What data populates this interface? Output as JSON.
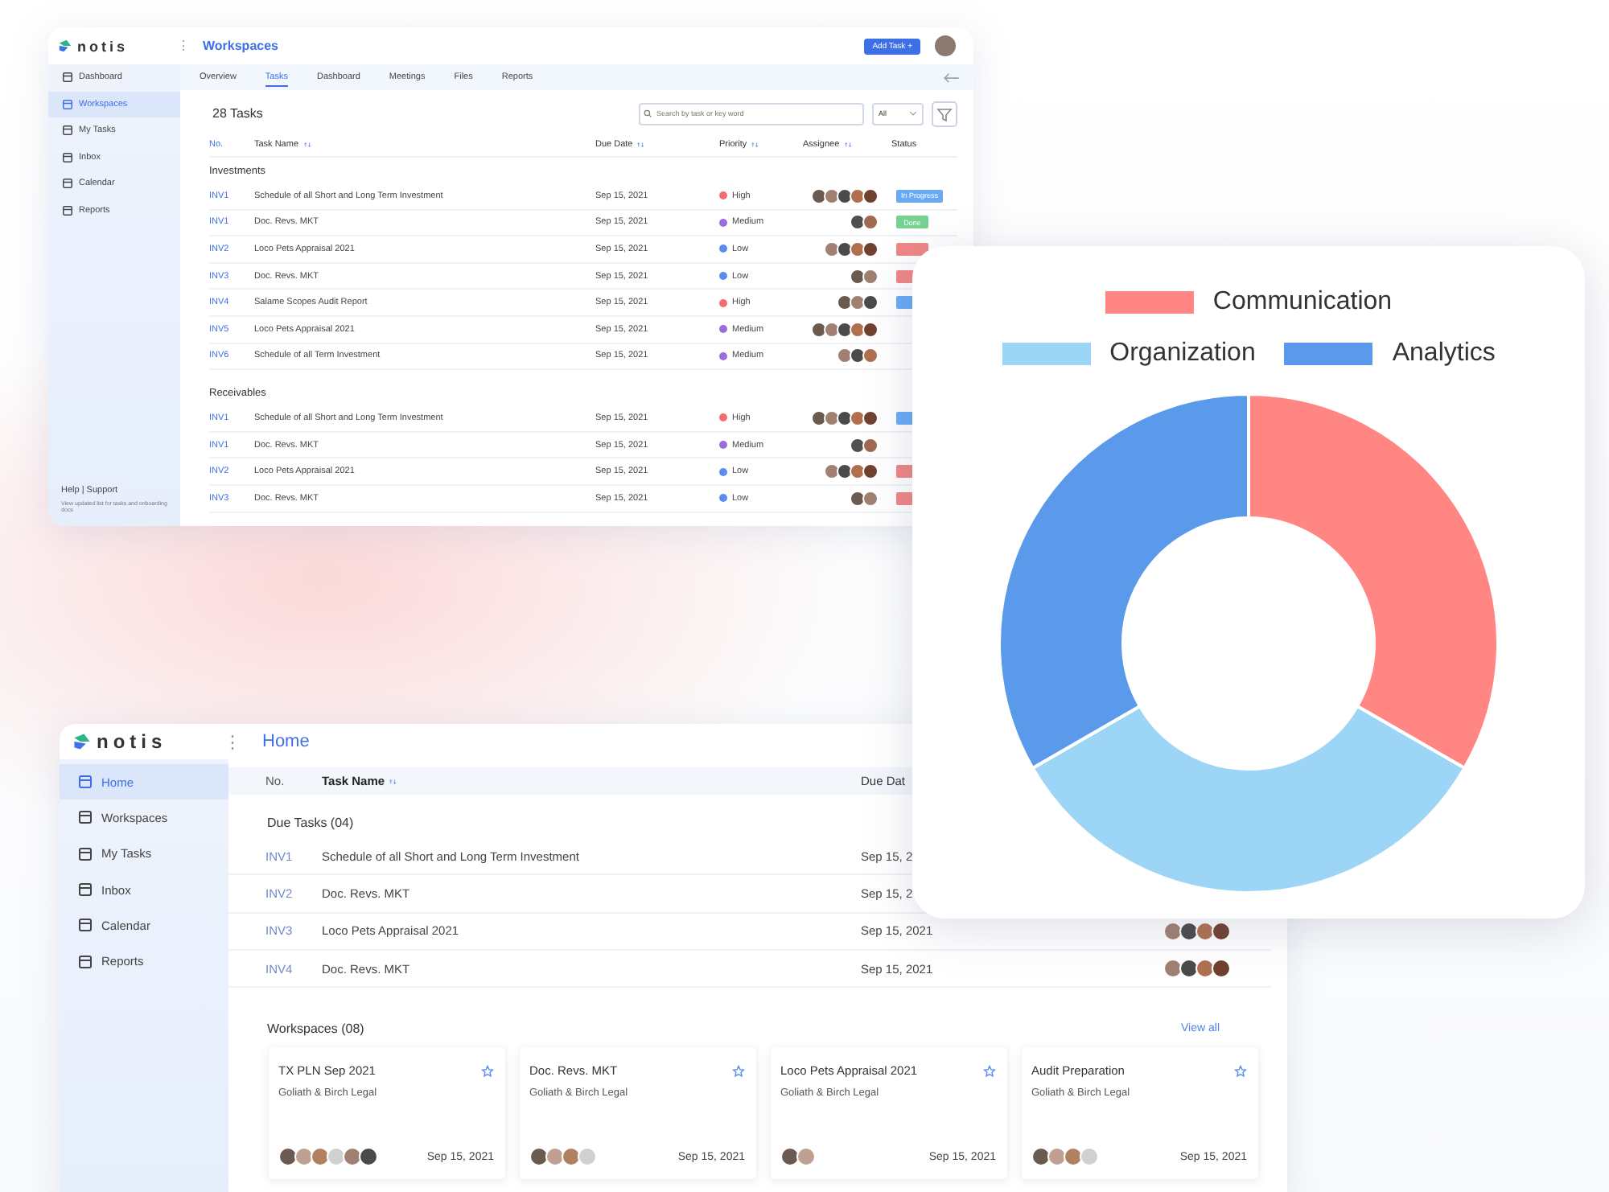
{
  "window_workspaces": {
    "logo": "notis",
    "menu_glyph": "⋮",
    "title": "Workspaces",
    "add_button": "Add Task +",
    "sidebar": {
      "items": [
        {
          "label": "Dashboard",
          "selected": false
        },
        {
          "label": "Workspaces",
          "selected": true
        },
        {
          "label": "My Tasks",
          "selected": false
        },
        {
          "label": "Inbox",
          "selected": false
        },
        {
          "label": "Calendar",
          "selected": false
        },
        {
          "label": "Reports",
          "selected": false
        }
      ],
      "help": "Help | Support",
      "note": "View updated list for tasks and onboarding docs"
    },
    "tabs": [
      {
        "label": "Overview",
        "selected": false
      },
      {
        "label": "Tasks",
        "selected": true
      },
      {
        "label": "Dashboard",
        "selected": false
      },
      {
        "label": "Meetings",
        "selected": false
      },
      {
        "label": "Files",
        "selected": false
      },
      {
        "label": "Reports",
        "selected": false
      }
    ],
    "task_count": "28 Tasks",
    "search": {
      "placeholder": "Search by task or key word"
    },
    "filter_select": "All",
    "columns": [
      "No.",
      "Task Name",
      "Due Date",
      "Priority",
      "Assignee",
      "Status"
    ],
    "groups": [
      {
        "title": "Investments",
        "rows": [
          {
            "no": "INV1",
            "name": "Schedule of all Short and Long Term Investment",
            "due": "Sep 15, 2021",
            "priority": {
              "label": "High",
              "color": "#f26d6d"
            },
            "avatars": [
              {
                "color": "#6b5a50"
              },
              {
                "color": "#a08070"
              },
              {
                "color": "#4a4a4a"
              },
              {
                "color": "#b07050"
              },
              {
                "color": "#704030"
              }
            ],
            "status": {
              "label": "In Progress",
              "color": "#6aaaf5"
            }
          },
          {
            "no": "INV1",
            "name": "Doc. Revs. MKT",
            "due": "Sep 15, 2021",
            "priority": {
              "label": "Medium",
              "color": "#9b6de0"
            },
            "avatars": [
              {
                "color": "#505050"
              },
              {
                "color": "#a06a50"
              }
            ],
            "status": {
              "label": "Done",
              "color": "#74d390"
            }
          },
          {
            "no": "INV2",
            "name": "Loco Pets Appraisal 2021",
            "due": "Sep 15, 2021",
            "priority": {
              "label": "Low",
              "color": "#5b8def"
            },
            "avatars": [
              {
                "color": "#a08070"
              },
              {
                "color": "#4a4a4a"
              },
              {
                "color": "#b07050"
              },
              {
                "color": "#704030"
              }
            ],
            "status": {
              "color": "#f08585"
            }
          },
          {
            "no": "INV3",
            "name": "Doc. Revs. MKT",
            "due": "Sep 15, 2021",
            "priority": {
              "label": "Low",
              "color": "#5b8def"
            },
            "avatars": [
              {
                "color": "#6b5a50"
              },
              {
                "color": "#a08070"
              }
            ],
            "status": {
              "color": "#f08585"
            }
          },
          {
            "no": "INV4",
            "name": "Salame Scopes Audit Report",
            "due": "Sep 15, 2021",
            "priority": {
              "label": "High",
              "color": "#f26d6d"
            },
            "avatars": [
              {
                "color": "#6b5a50"
              },
              {
                "color": "#a08070"
              },
              {
                "color": "#4a4a4a"
              }
            ],
            "status": {
              "color": "#6aaaf5"
            }
          },
          {
            "no": "INV5",
            "name": "Loco Pets Appraisal 2021",
            "due": "Sep 15, 2021",
            "priority": {
              "label": "Medium",
              "color": "#9b6de0"
            },
            "avatars": [
              {
                "color": "#6b5a50"
              },
              {
                "color": "#a08070"
              },
              {
                "color": "#4a4a4a"
              },
              {
                "color": "#b07050"
              },
              {
                "color": "#704030"
              }
            ]
          },
          {
            "no": "INV6",
            "name": "Schedule of all Term Investment",
            "due": "Sep 15, 2021",
            "priority": {
              "label": "Medium",
              "color": "#9b6de0"
            },
            "avatars": [
              {
                "color": "#a08070"
              },
              {
                "color": "#4a4a4a"
              },
              {
                "color": "#b07050"
              }
            ]
          }
        ]
      },
      {
        "title": "Receivables",
        "rows": [
          {
            "no": "INV1",
            "name": "Schedule of all Short and Long Term Investment",
            "due": "Sep 15, 2021",
            "priority": {
              "label": "High",
              "color": "#f26d6d"
            },
            "avatars": [
              {
                "color": "#6b5a50"
              },
              {
                "color": "#a08070"
              },
              {
                "color": "#4a4a4a"
              },
              {
                "color": "#b07050"
              },
              {
                "color": "#704030"
              }
            ],
            "status": {
              "color": "#6aaaf5"
            }
          },
          {
            "no": "INV1",
            "name": "Doc. Revs. MKT",
            "due": "Sep 15, 2021",
            "priority": {
              "label": "Medium",
              "color": "#9b6de0"
            },
            "avatars": [
              {
                "color": "#505050"
              },
              {
                "color": "#a06a50"
              }
            ]
          },
          {
            "no": "INV2",
            "name": "Loco Pets Appraisal 2021",
            "due": "Sep 15, 2021",
            "priority": {
              "label": "Low",
              "color": "#5b8def"
            },
            "avatars": [
              {
                "color": "#a08070"
              },
              {
                "color": "#4a4a4a"
              },
              {
                "color": "#b07050"
              },
              {
                "color": "#704030"
              }
            ],
            "status": {
              "color": "#f08585"
            }
          },
          {
            "no": "INV3",
            "name": "Doc. Revs. MKT",
            "due": "Sep 15, 2021",
            "priority": {
              "label": "Low",
              "color": "#5b8def"
            },
            "avatars": [
              {
                "color": "#6b5a50"
              },
              {
                "color": "#a08070"
              }
            ],
            "status": {
              "color": "#f08585"
            }
          }
        ]
      }
    ]
  },
  "window_home": {
    "logo": "notis",
    "menu_glyph": "⋮",
    "title": "Home",
    "sidebar": {
      "items": [
        {
          "label": "Home",
          "selected": true
        },
        {
          "label": "Workspaces",
          "selected": false
        },
        {
          "label": "My Tasks",
          "selected": false
        },
        {
          "label": "Inbox",
          "selected": false
        },
        {
          "label": "Calendar",
          "selected": false
        },
        {
          "label": "Reports",
          "selected": false
        }
      ]
    },
    "columns": [
      "No.",
      "Task Name",
      "Due Dat"
    ],
    "due_tasks": {
      "title": "Due Tasks (04)",
      "rows": [
        {
          "no": "INV1",
          "name": "Schedule of all Short and Long Term Investment",
          "due": "Sep 15, 2"
        },
        {
          "no": "INV2",
          "name": "Doc. Revs. MKT",
          "due": "Sep 15, 2"
        },
        {
          "no": "INV3",
          "name": "Loco Pets Appraisal 2021",
          "due": "Sep 15, 2021",
          "avatars": [
            {
              "color": "#a08070"
            },
            {
              "color": "#4a4a4a"
            },
            {
              "color": "#b07050"
            },
            {
              "color": "#704030"
            }
          ]
        },
        {
          "no": "INV4",
          "name": "Doc. Revs. MKT",
          "due": "Sep 15, 2021",
          "avatars": [
            {
              "color": "#a08070"
            },
            {
              "color": "#4a4a4a"
            },
            {
              "color": "#b07050"
            },
            {
              "color": "#704030"
            }
          ]
        }
      ]
    },
    "workspaces": {
      "title": "Workspaces (08)",
      "view_all": "View all",
      "cards": [
        {
          "title": "TX PLN Sep 2021",
          "client": "Goliath & Birch Legal",
          "date": "Sep 15, 2021",
          "avatars": [
            {
              "color": "#6b5a50"
            },
            {
              "color": "#c0a090"
            },
            {
              "color": "#b08060"
            },
            {
              "color": "#d0d0d0"
            },
            {
              "color": "#a08070"
            },
            {
              "color": "#4a4a4a"
            }
          ]
        },
        {
          "title": "Doc. Revs. MKT",
          "client": "Goliath & Birch Legal",
          "date": "Sep 15, 2021",
          "avatars": [
            {
              "color": "#6b5a50"
            },
            {
              "color": "#c0a090"
            },
            {
              "color": "#b08060"
            },
            {
              "color": "#d0d0d0"
            }
          ]
        },
        {
          "title": "Loco Pets Appraisal 2021",
          "client": "Goliath & Birch Legal",
          "date": "Sep 15, 2021",
          "avatars": [
            {
              "color": "#6b5a50"
            },
            {
              "color": "#c0a090"
            }
          ]
        },
        {
          "title": "Audit Preparation",
          "client": "Goliath & Birch Legal",
          "date": "Sep 15, 2021",
          "avatars": [
            {
              "color": "#6b5a50"
            },
            {
              "color": "#c0a090"
            },
            {
              "color": "#b08060"
            },
            {
              "color": "#d0d0d0"
            }
          ]
        }
      ]
    }
  },
  "chart_card": {
    "legend": [
      {
        "label": "Communication",
        "color": "#ff8683"
      },
      {
        "label": "Organization",
        "color": "#9dd5f7"
      },
      {
        "label": "Analytics",
        "color": "#5b9aea"
      }
    ]
  }
}
